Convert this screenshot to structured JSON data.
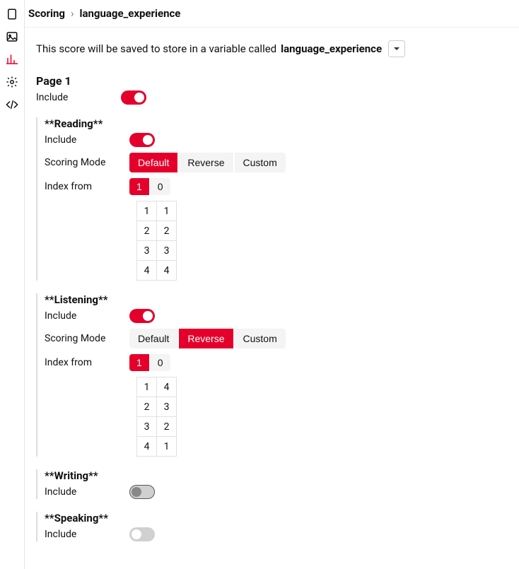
{
  "breadcrumb": {
    "root": "Scoring",
    "page": "language_experience"
  },
  "intro": {
    "prefix": "This score will be saved to store in a variable called",
    "varname": "language_experience"
  },
  "labels": {
    "include": "Include",
    "scoring_mode": "Scoring Mode",
    "index_from": "Index from"
  },
  "scoring_mode_options": [
    "Default",
    "Reverse",
    "Custom"
  ],
  "index_from_options": [
    "1",
    "0"
  ],
  "page": {
    "title": "Page 1",
    "include": true
  },
  "sections": [
    {
      "title": "**Reading**",
      "include": true,
      "scoring_mode": "Default",
      "index_from": "1",
      "values": [
        [
          "1",
          "1"
        ],
        [
          "2",
          "2"
        ],
        [
          "3",
          "3"
        ],
        [
          "4",
          "4"
        ]
      ]
    },
    {
      "title": "**Listening**",
      "include": true,
      "scoring_mode": "Reverse",
      "index_from": "1",
      "values": [
        [
          "1",
          "4"
        ],
        [
          "2",
          "3"
        ],
        [
          "3",
          "2"
        ],
        [
          "4",
          "1"
        ]
      ]
    },
    {
      "title": "**Writing**",
      "include": false,
      "toggle_style": "dark"
    },
    {
      "title": "**Speaking**",
      "include": false,
      "toggle_style": "grey"
    }
  ]
}
